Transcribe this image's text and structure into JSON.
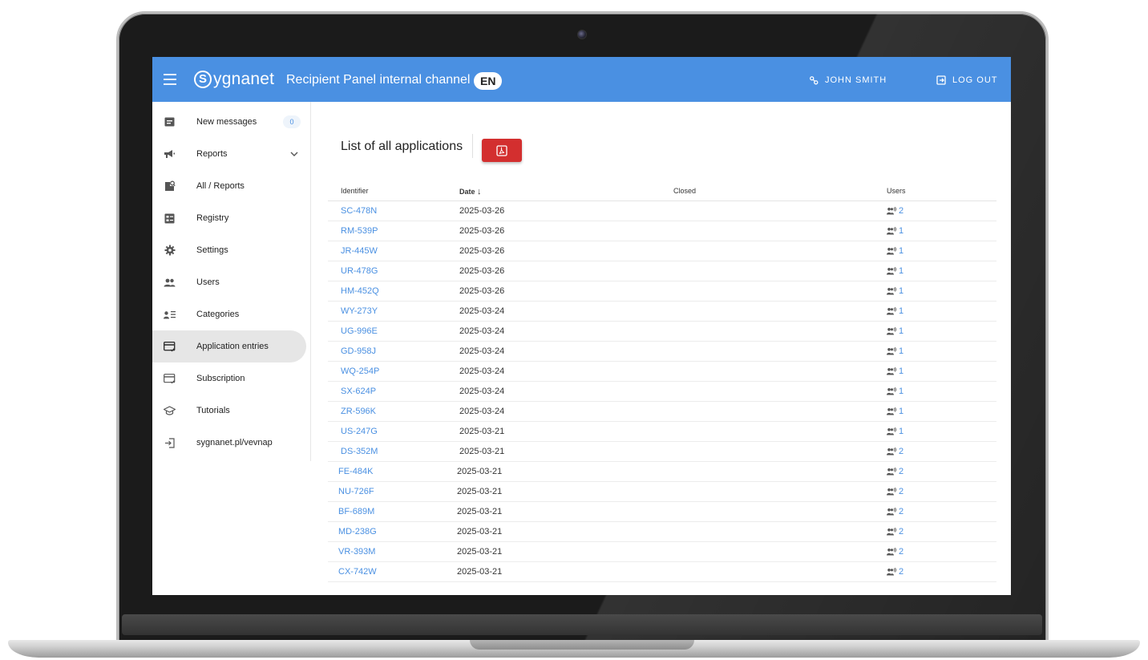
{
  "appbar": {
    "brand_letter": "S",
    "brand_name": "ygnanet",
    "title": "Recipient Panel internal channel",
    "language": "EN",
    "user_name": "JOHN SMITH",
    "logout_label": "LOG OUT",
    "color": "#4a90e2"
  },
  "sidebar": {
    "items": [
      {
        "label": "New messages",
        "icon": "inbox-icon",
        "badge": "0"
      },
      {
        "label": "Reports",
        "icon": "megaphone-icon"
      },
      {
        "label": "All / Reports",
        "icon": "search-document-icon"
      },
      {
        "label": "Registry",
        "icon": "registry-icon"
      },
      {
        "label": "Settings",
        "icon": "gear-icon"
      },
      {
        "label": "Users",
        "icon": "users-icon"
      },
      {
        "label": "Categories",
        "icon": "category-list-icon"
      },
      {
        "label": "Application entries",
        "icon": "card-check-icon",
        "active": true
      },
      {
        "label": "Subscription",
        "icon": "card-check-icon"
      },
      {
        "label": "Tutorials",
        "icon": "graduation-cap-icon"
      },
      {
        "label": "sygnanet.pl/vevnap",
        "icon": "login-icon"
      }
    ]
  },
  "main": {
    "heading": "List of all applications",
    "export_icon": "pdf-icon",
    "export_color": "#d32f2f"
  },
  "table": {
    "columns": {
      "identifier": "Identifier",
      "date": "Date",
      "sort_arrow": "↓",
      "closed": "Closed",
      "users": "Users"
    },
    "rows": [
      {
        "id": "SC-478N",
        "date": "2025-03-26",
        "closed": "",
        "users": "2"
      },
      {
        "id": "RM-539P",
        "date": "2025-03-26",
        "closed": "",
        "users": "1"
      },
      {
        "id": "JR-445W",
        "date": "2025-03-26",
        "closed": "",
        "users": "1"
      },
      {
        "id": "UR-478G",
        "date": "2025-03-26",
        "closed": "",
        "users": "1"
      },
      {
        "id": "HM-452Q",
        "date": "2025-03-26",
        "closed": "",
        "users": "1"
      },
      {
        "id": "WY-273Y",
        "date": "2025-03-24",
        "closed": "",
        "users": "1"
      },
      {
        "id": "UG-996E",
        "date": "2025-03-24",
        "closed": "",
        "users": "1"
      },
      {
        "id": "GD-958J",
        "date": "2025-03-24",
        "closed": "",
        "users": "1"
      },
      {
        "id": "WQ-254P",
        "date": "2025-03-24",
        "closed": "",
        "users": "1"
      },
      {
        "id": "SX-624P",
        "date": "2025-03-24",
        "closed": "",
        "users": "1"
      },
      {
        "id": "ZR-596K",
        "date": "2025-03-24",
        "closed": "",
        "users": "1"
      },
      {
        "id": "US-247G",
        "date": "2025-03-21",
        "closed": "",
        "users": "1"
      },
      {
        "id": "DS-352M",
        "date": "2025-03-21",
        "closed": "",
        "users": "2"
      },
      {
        "id": "FE-484K",
        "date": "2025-03-21",
        "closed": "",
        "users": "2"
      },
      {
        "id": "NU-726F",
        "date": "2025-03-21",
        "closed": "",
        "users": "2"
      },
      {
        "id": "BF-689M",
        "date": "2025-03-21",
        "closed": "",
        "users": "2"
      },
      {
        "id": "MD-238G",
        "date": "2025-03-21",
        "closed": "",
        "users": "2"
      },
      {
        "id": "VR-393M",
        "date": "2025-03-21",
        "closed": "",
        "users": "2"
      },
      {
        "id": "CX-742W",
        "date": "2025-03-21",
        "closed": "",
        "users": "2"
      }
    ]
  }
}
